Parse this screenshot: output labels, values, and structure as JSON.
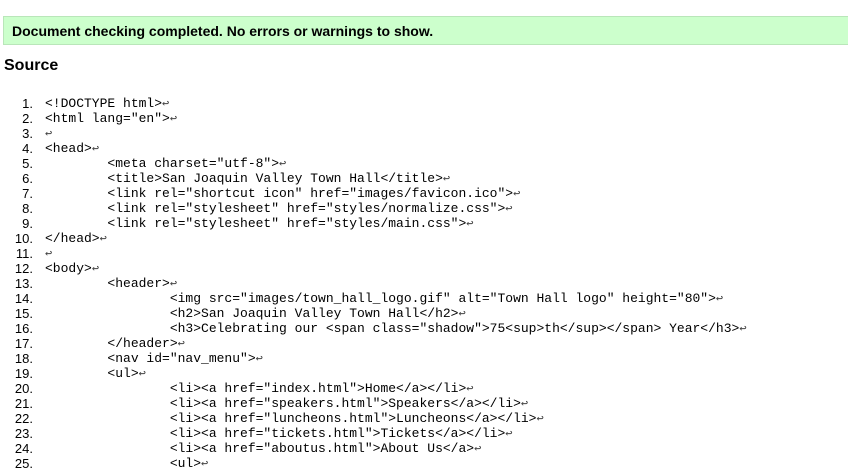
{
  "message": "Document checking completed. No errors or warnings to show.",
  "source_heading": "Source",
  "newline_glyph": "↩",
  "lines": [
    {
      "n": "1.",
      "indent": "",
      "text": "<!DOCTYPE html>"
    },
    {
      "n": "2.",
      "indent": "",
      "text": "<html lang=\"en\">"
    },
    {
      "n": "3.",
      "indent": "",
      "text": ""
    },
    {
      "n": "4.",
      "indent": "",
      "text": "<head>"
    },
    {
      "n": "5.",
      "indent": "        ",
      "text": "<meta charset=\"utf-8\">"
    },
    {
      "n": "6.",
      "indent": "        ",
      "text": "<title>San Joaquin Valley Town Hall</title>"
    },
    {
      "n": "7.",
      "indent": "        ",
      "text": "<link rel=\"shortcut icon\" href=\"images/favicon.ico\">"
    },
    {
      "n": "8.",
      "indent": "        ",
      "text": "<link rel=\"stylesheet\" href=\"styles/normalize.css\">"
    },
    {
      "n": "9.",
      "indent": "        ",
      "text": "<link rel=\"stylesheet\" href=\"styles/main.css\">"
    },
    {
      "n": "10.",
      "indent": "",
      "text": "</head>"
    },
    {
      "n": "11.",
      "indent": "",
      "text": ""
    },
    {
      "n": "12.",
      "indent": "",
      "text": "<body>"
    },
    {
      "n": "13.",
      "indent": "        ",
      "text": "<header>"
    },
    {
      "n": "14.",
      "indent": "                ",
      "text": "<img src=\"images/town_hall_logo.gif\" alt=\"Town Hall logo\" height=\"80\">"
    },
    {
      "n": "15.",
      "indent": "                ",
      "text": "<h2>San Joaquin Valley Town Hall</h2>"
    },
    {
      "n": "16.",
      "indent": "                ",
      "text": "<h3>Celebrating our <span class=\"shadow\">75<sup>th</sup></span> Year</h3>"
    },
    {
      "n": "17.",
      "indent": "        ",
      "text": "</header>"
    },
    {
      "n": "18.",
      "indent": "        ",
      "text": "<nav id=\"nav_menu\">"
    },
    {
      "n": "19.",
      "indent": "        ",
      "text": "<ul>"
    },
    {
      "n": "20.",
      "indent": "                ",
      "text": "<li><a href=\"index.html\">Home</a></li>"
    },
    {
      "n": "21.",
      "indent": "                ",
      "text": "<li><a href=\"speakers.html\">Speakers</a></li>"
    },
    {
      "n": "22.",
      "indent": "                ",
      "text": "<li><a href=\"luncheons.html\">Luncheons</a></li>"
    },
    {
      "n": "23.",
      "indent": "                ",
      "text": "<li><a href=\"tickets.html\">Tickets</a></li>"
    },
    {
      "n": "24.",
      "indent": "                ",
      "text": "<li><a href=\"aboutus.html\">About Us</a>"
    },
    {
      "n": "25.",
      "indent": "                ",
      "text": "<ul>"
    }
  ]
}
